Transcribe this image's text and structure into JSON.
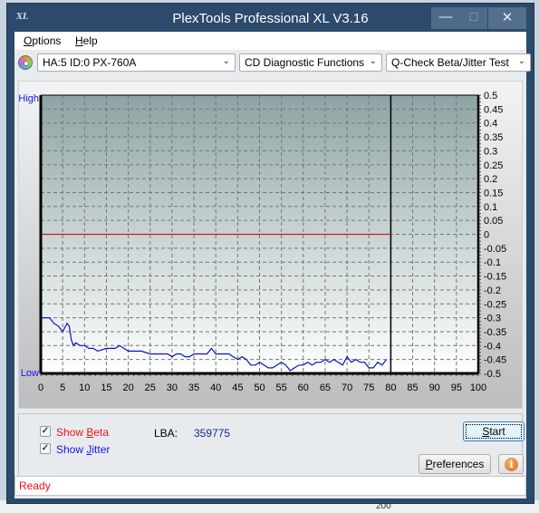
{
  "window": {
    "title": "PlexTools Professional XL V3.16",
    "app_icon": "XL",
    "controls": {
      "minimize": "—",
      "maximize": "☐",
      "close": "✕"
    }
  },
  "menu": [
    {
      "label": "Options",
      "accel": "O"
    },
    {
      "label": "Help",
      "accel": "H"
    }
  ],
  "toolbar": {
    "drive_icon": "cd-drive-icon",
    "drive_select": "HA:5 ID:0  PX-760A",
    "function_select": "CD Diagnostic Functions",
    "test_select": "Q-Check Beta/Jitter Test"
  },
  "chart_data": {
    "type": "line",
    "title": "",
    "xlabel": "",
    "ylabel_left_top": "High",
    "ylabel_left_bottom": "Low",
    "xlim": [
      0,
      100
    ],
    "ylim": [
      -0.5,
      0.5
    ],
    "x_ticks": [
      0,
      5,
      10,
      15,
      20,
      25,
      30,
      35,
      40,
      45,
      50,
      55,
      60,
      65,
      70,
      75,
      80,
      85,
      90,
      95,
      100
    ],
    "y_ticks": [
      0.5,
      0.45,
      0.4,
      0.35,
      0.3,
      0.25,
      0.2,
      0.15,
      0.1,
      0.05,
      0,
      -0.05,
      -0.1,
      -0.15,
      -0.2,
      -0.25,
      -0.3,
      -0.35,
      -0.4,
      -0.45,
      -0.5
    ],
    "grid": true,
    "end_marker_x": 80,
    "series": [
      {
        "name": "Beta",
        "color": "#e8141e",
        "x": [
          0,
          80
        ],
        "values": [
          0.0,
          0.0
        ]
      },
      {
        "name": "Jitter",
        "color": "#0a14c8",
        "x": [
          0,
          1,
          2,
          3,
          4,
          5,
          6,
          6.5,
          7,
          7.5,
          8,
          9,
          10,
          11,
          12,
          13,
          15,
          17,
          18,
          19,
          20,
          21,
          22,
          23,
          25,
          27,
          29,
          30,
          31,
          32,
          33,
          34,
          35,
          36,
          37,
          38,
          39,
          39.5,
          40,
          41,
          42,
          43,
          44,
          45,
          46,
          47,
          48,
          49,
          50,
          51,
          52,
          53,
          54,
          55,
          56,
          57,
          58,
          59,
          60,
          61,
          62,
          63,
          64,
          65,
          66,
          67,
          68,
          69,
          70,
          71,
          72,
          73,
          74,
          75,
          76,
          77,
          78,
          79
        ],
        "values": [
          -0.3,
          -0.3,
          -0.3,
          -0.32,
          -0.33,
          -0.35,
          -0.32,
          -0.33,
          -0.38,
          -0.4,
          -0.39,
          -0.4,
          -0.4,
          -0.41,
          -0.41,
          -0.42,
          -0.41,
          -0.41,
          -0.4,
          -0.41,
          -0.42,
          -0.42,
          -0.42,
          -0.42,
          -0.43,
          -0.43,
          -0.43,
          -0.44,
          -0.43,
          -0.43,
          -0.44,
          -0.44,
          -0.43,
          -0.43,
          -0.43,
          -0.43,
          -0.41,
          -0.42,
          -0.43,
          -0.43,
          -0.43,
          -0.43,
          -0.44,
          -0.45,
          -0.44,
          -0.45,
          -0.47,
          -0.47,
          -0.46,
          -0.47,
          -0.48,
          -0.48,
          -0.47,
          -0.46,
          -0.47,
          -0.49,
          -0.48,
          -0.47,
          -0.47,
          -0.46,
          -0.47,
          -0.46,
          -0.46,
          -0.45,
          -0.46,
          -0.45,
          -0.46,
          -0.47,
          -0.44,
          -0.46,
          -0.45,
          -0.46,
          -0.46,
          -0.48,
          -0.48,
          -0.46,
          -0.47,
          -0.45
        ]
      }
    ]
  },
  "bottom": {
    "show_beta": {
      "label_pre": "Show ",
      "accel": "B",
      "label_post": "eta",
      "checked": true,
      "color": "#e8141e"
    },
    "show_jitter": {
      "label_pre": "Show ",
      "accel": "J",
      "label_post": "itter",
      "checked": true,
      "color": "#1414e6"
    },
    "lba_label": "LBA:",
    "lba_value": "359775",
    "start_accel": "S",
    "start_rest": "tart",
    "preferences_accel": "P",
    "preferences_rest": "references",
    "info_icon": "i"
  },
  "status": {
    "text": "Ready"
  },
  "background": {
    "partial_text": "200"
  }
}
